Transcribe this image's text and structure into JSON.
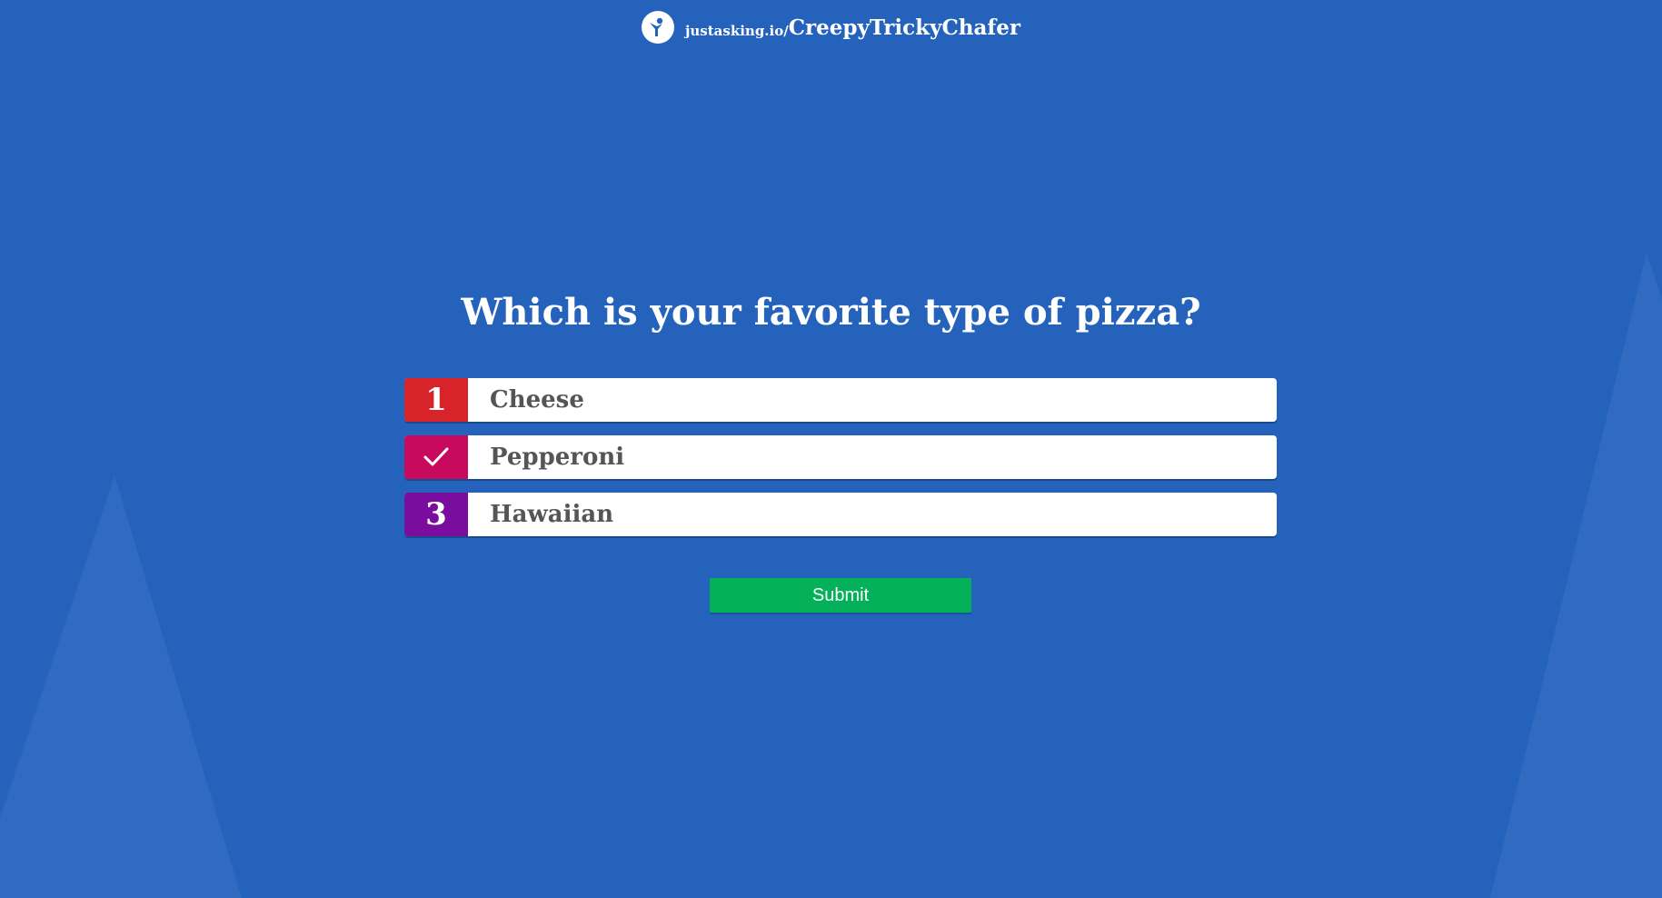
{
  "header": {
    "logo_icon": "justasking-logo-icon",
    "brand": "justasking.io/",
    "room_code": "CreepyTrickyChafer"
  },
  "poll": {
    "question": "Which is your favorite type of pizza?",
    "options": [
      {
        "badge": "1",
        "label": "Cheese",
        "badge_color": "#d8232a",
        "selected": false
      },
      {
        "badge": "",
        "badge_icon": "checkmark-icon",
        "label": "Pepperoni",
        "badge_color": "#c70a5e",
        "selected": true
      },
      {
        "badge": "3",
        "label": "Hawaiian",
        "badge_color": "#7a0c9e",
        "selected": false
      }
    ]
  },
  "submit": {
    "label": "Submit",
    "color": "#04b15a"
  },
  "colors": {
    "background": "#2462bc",
    "background_shapes": "#3a72c4"
  }
}
